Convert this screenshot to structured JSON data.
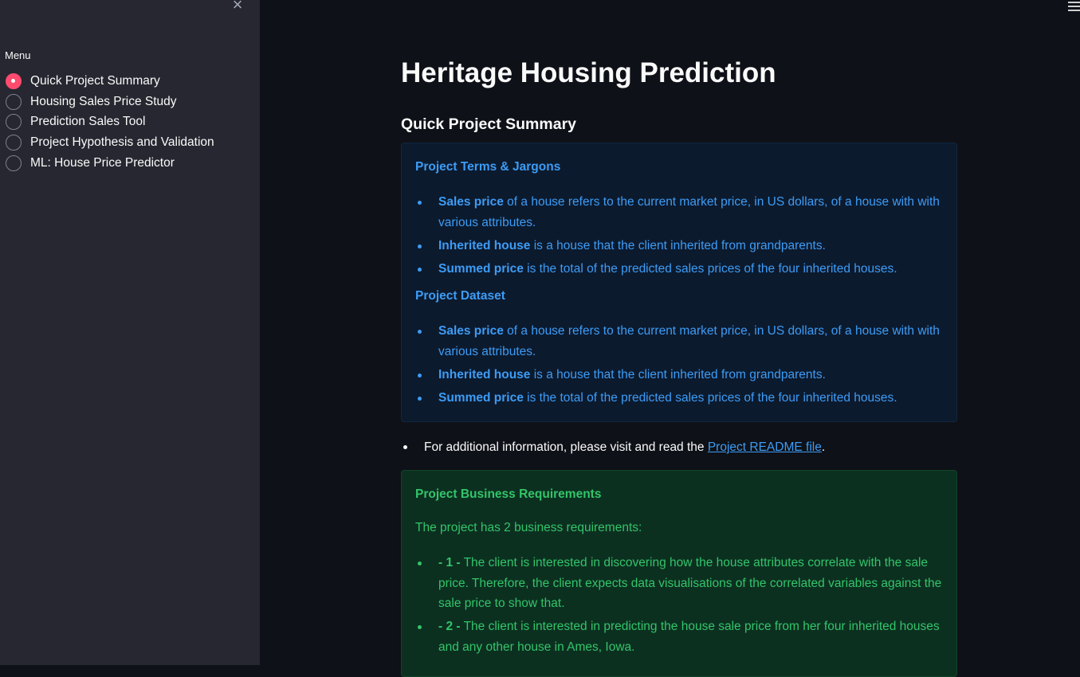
{
  "sidebar": {
    "close_glyph": "×",
    "menu_label": "Menu",
    "items": [
      {
        "label": "Quick Project Summary",
        "selected": true
      },
      {
        "label": "Housing Sales Price Study",
        "selected": false
      },
      {
        "label": "Prediction Sales Tool",
        "selected": false
      },
      {
        "label": "Project Hypothesis and Validation",
        "selected": false
      },
      {
        "label": "ML: House Price Predictor",
        "selected": false
      }
    ]
  },
  "header": {
    "menu_icon": "hamburger-icon"
  },
  "main": {
    "title": "Heritage Housing Prediction",
    "section_title": "Quick Project Summary",
    "info_box": {
      "terms_heading": "Project Terms & Jargons",
      "terms": [
        {
          "bold": "Sales price",
          "text": " of a house refers to the current market price, in US dollars, of a house with with various attributes."
        },
        {
          "bold": "Inherited house",
          "text": " is a house that the client inherited from grandparents."
        },
        {
          "bold": "Summed price",
          "text": " is the total of the predicted sales prices of the four inherited houses."
        }
      ],
      "dataset_heading": "Project Dataset",
      "dataset": [
        {
          "bold": "Sales price",
          "text": " of a house refers to the current market price, in US dollars, of a house with with various attributes."
        },
        {
          "bold": "Inherited house",
          "text": " is a house that the client inherited from grandparents."
        },
        {
          "bold": "Summed price",
          "text": " is the total of the predicted sales prices of the four inherited houses."
        }
      ]
    },
    "readme": {
      "prefix": "For additional information, please visit and read the ",
      "link_text": "Project README file",
      "suffix": "."
    },
    "business_box": {
      "heading": "Project Business Requirements",
      "intro": "The project has 2 business requirements:",
      "requirements": [
        {
          "bold": "- 1 -",
          "text": " The client is interested in discovering how the house attributes correlate with the sale price. Therefore, the client expects data visualisations of the correlated variables against the sale price to show that."
        },
        {
          "bold": "- 2 -",
          "text": " The client is interested in predicting the house sale price from her four inherited houses and any other house in Ames, Iowa."
        }
      ]
    }
  },
  "colors": {
    "background": "#0e1117",
    "sidebar": "#262730",
    "accent_radio": "#ff4b6e",
    "info_text": "#3d9cf5",
    "info_bg": "#0c1a2e",
    "success_text": "#33c46a",
    "success_bg": "#0c3020"
  }
}
